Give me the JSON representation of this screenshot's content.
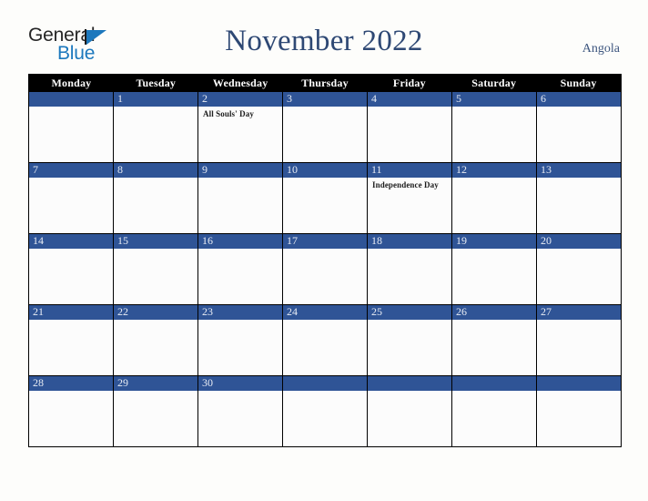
{
  "brand": {
    "name_line1": "General",
    "name_line2": "Blue",
    "triangle_color": "#1c78bd"
  },
  "header": {
    "title": "November 2022",
    "region": "Angola",
    "title_color": "#2e4874"
  },
  "calendar": {
    "day_headers": [
      "Monday",
      "Tuesday",
      "Wednesday",
      "Thursday",
      "Friday",
      "Saturday",
      "Sunday"
    ],
    "band_color": "#2f5496",
    "header_bg": "#000000",
    "cell_bg": "#fcfcfc",
    "weeks": [
      [
        {
          "date": "",
          "events": []
        },
        {
          "date": "1",
          "events": []
        },
        {
          "date": "2",
          "events": [
            "All Souls' Day"
          ]
        },
        {
          "date": "3",
          "events": []
        },
        {
          "date": "4",
          "events": []
        },
        {
          "date": "5",
          "events": []
        },
        {
          "date": "6",
          "events": []
        }
      ],
      [
        {
          "date": "7",
          "events": []
        },
        {
          "date": "8",
          "events": []
        },
        {
          "date": "9",
          "events": []
        },
        {
          "date": "10",
          "events": []
        },
        {
          "date": "11",
          "events": [
            "Independence Day"
          ]
        },
        {
          "date": "12",
          "events": []
        },
        {
          "date": "13",
          "events": []
        }
      ],
      [
        {
          "date": "14",
          "events": []
        },
        {
          "date": "15",
          "events": []
        },
        {
          "date": "16",
          "events": []
        },
        {
          "date": "17",
          "events": []
        },
        {
          "date": "18",
          "events": []
        },
        {
          "date": "19",
          "events": []
        },
        {
          "date": "20",
          "events": []
        }
      ],
      [
        {
          "date": "21",
          "events": []
        },
        {
          "date": "22",
          "events": []
        },
        {
          "date": "23",
          "events": []
        },
        {
          "date": "24",
          "events": []
        },
        {
          "date": "25",
          "events": []
        },
        {
          "date": "26",
          "events": []
        },
        {
          "date": "27",
          "events": []
        }
      ],
      [
        {
          "date": "28",
          "events": []
        },
        {
          "date": "29",
          "events": []
        },
        {
          "date": "30",
          "events": []
        },
        {
          "date": "",
          "events": []
        },
        {
          "date": "",
          "events": []
        },
        {
          "date": "",
          "events": []
        },
        {
          "date": "",
          "events": []
        }
      ]
    ]
  }
}
